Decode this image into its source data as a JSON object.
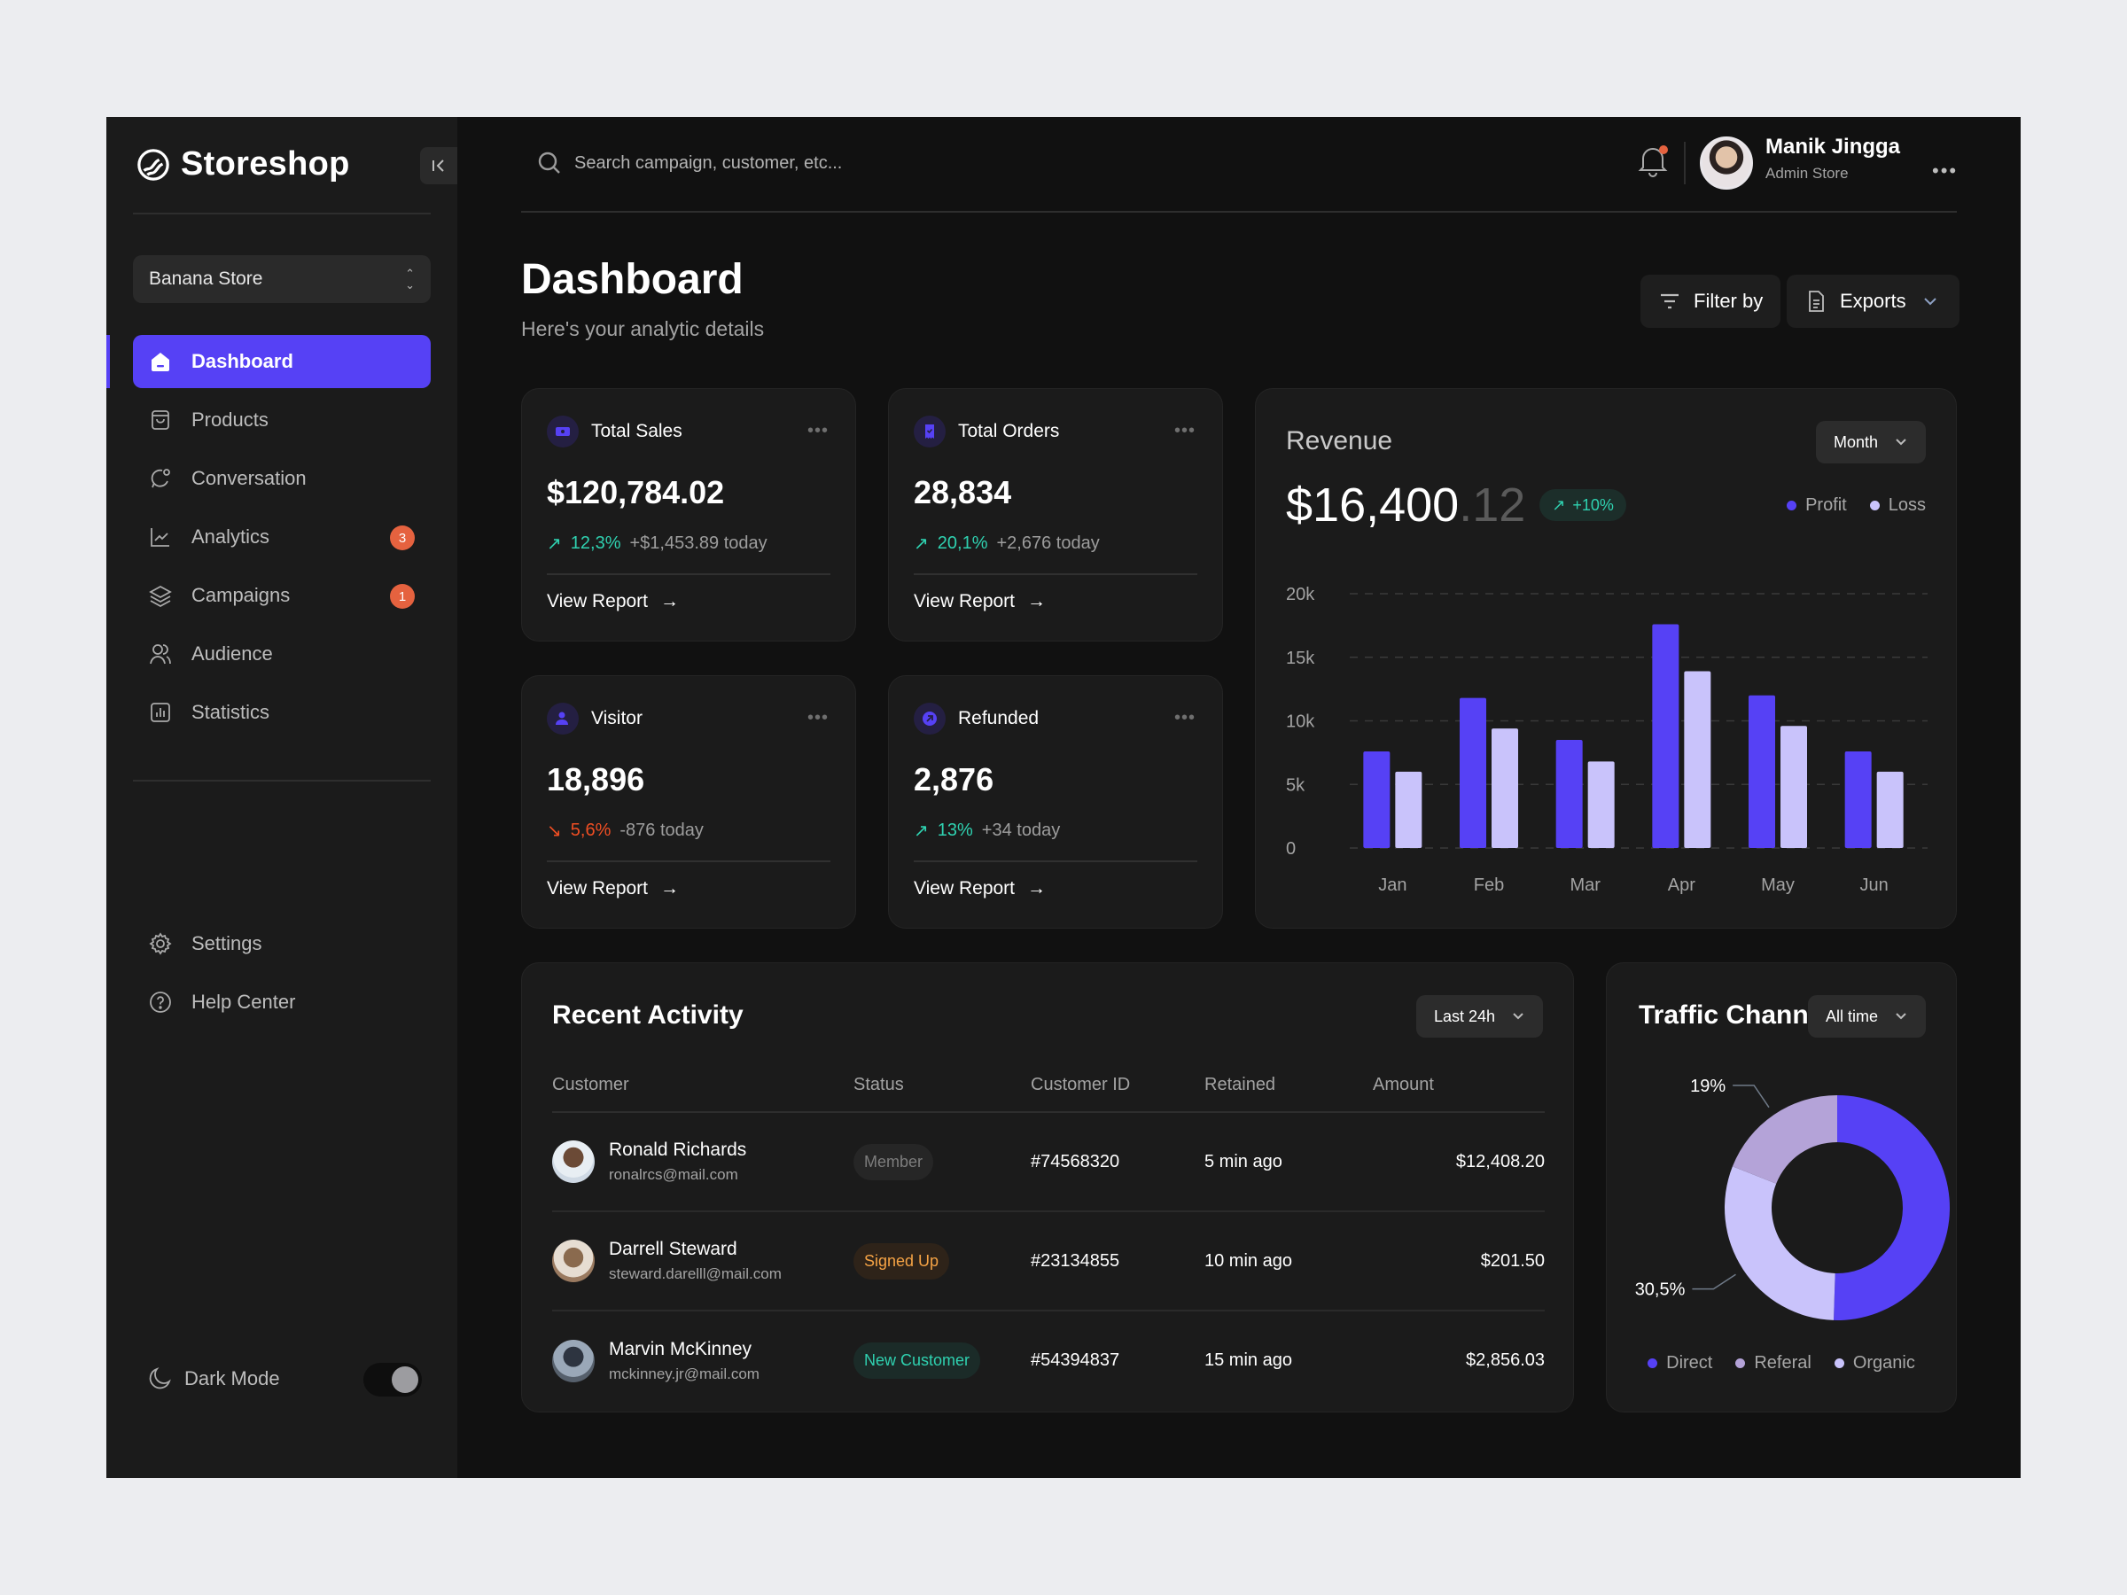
{
  "app": {
    "name": "Storeshop"
  },
  "sidebar": {
    "store_selector": "Banana Store",
    "items": [
      {
        "label": "Dashboard",
        "icon": "home-icon",
        "active": true
      },
      {
        "label": "Products",
        "icon": "shopping-bag-icon"
      },
      {
        "label": "Conversation",
        "icon": "chat-icon"
      },
      {
        "label": "Analytics",
        "icon": "line-chart-icon",
        "badge": "3"
      },
      {
        "label": "Campaigns",
        "icon": "layers-icon",
        "badge": "1"
      },
      {
        "label": "Audience",
        "icon": "users-icon"
      },
      {
        "label": "Statistics",
        "icon": "bar-chart-icon"
      }
    ],
    "bottom_items": [
      {
        "label": "Settings",
        "icon": "gear-icon"
      },
      {
        "label": "Help Center",
        "icon": "help-circle-icon"
      }
    ],
    "dark_mode": {
      "label": "Dark Mode",
      "enabled": true
    }
  },
  "header": {
    "search_placeholder": "Search campaign, customer, etc...",
    "user": {
      "name": "Manik Jingga",
      "role": "Admin Store"
    }
  },
  "page": {
    "title": "Dashboard",
    "subtitle": "Here's your analytic details",
    "filter_label": "Filter by",
    "exports_label": "Exports"
  },
  "stats": [
    {
      "title": "Total Sales",
      "value": "$120,784.02",
      "change": "12,3%",
      "direction": "up",
      "today": "+$1,453.89 today",
      "link": "View Report"
    },
    {
      "title": "Total Orders",
      "value": "28,834",
      "change": "20,1%",
      "direction": "up",
      "today": "+2,676 today",
      "link": "View Report"
    },
    {
      "title": "Visitor",
      "value": "18,896",
      "change": "5,6%",
      "direction": "down",
      "today": "-876 today",
      "link": "View Report"
    },
    {
      "title": "Refunded",
      "value": "2,876",
      "change": "13%",
      "direction": "up",
      "today": "+34 today",
      "link": "View Report"
    }
  ],
  "revenue": {
    "title": "Revenue",
    "value_main": "$16,400",
    "value_cents": ".12",
    "change": "+10%",
    "period": "Month"
  },
  "chart_data": [
    {
      "type": "bar",
      "title": "Revenue",
      "categories": [
        "Jan",
        "Feb",
        "Mar",
        "Apr",
        "May",
        "Jun"
      ],
      "series": [
        {
          "name": "Profit",
          "color": "#5641f5",
          "values": [
            7600,
            11800,
            8500,
            17600,
            12000,
            7600
          ]
        },
        {
          "name": "Loss",
          "color": "#c9c3fb",
          "values": [
            6000,
            9400,
            6800,
            13900,
            9600,
            6000
          ]
        }
      ],
      "yticks": [
        "0",
        "5k",
        "10k",
        "15k",
        "20k"
      ],
      "ylim": [
        0,
        20000
      ],
      "grid": true,
      "legend": "top-right"
    },
    {
      "type": "pie",
      "title": "Traffic Channel",
      "slices": [
        {
          "name": "Direct",
          "value": 50.5,
          "label": "50,5%",
          "color": "#5641f5"
        },
        {
          "name": "Organic",
          "value": 30.5,
          "label": "30,5%",
          "color": "#c9c3fb"
        },
        {
          "name": "Referal",
          "value": 19,
          "label": "19%",
          "color": "#b4a3d8"
        }
      ],
      "legend_order": [
        "Direct",
        "Referal",
        "Organic"
      ],
      "legend": "bottom"
    }
  ],
  "activity": {
    "title": "Recent Activity",
    "period": "Last 24h",
    "columns": [
      "Customer",
      "Status",
      "Customer ID",
      "Retained",
      "Amount"
    ],
    "rows": [
      {
        "name": "Ronald Richards",
        "email": "ronalrcs@mail.com",
        "status": "Member",
        "status_type": "member",
        "id": "#74568320",
        "retained": "5 min ago",
        "amount": "$12,408.20"
      },
      {
        "name": "Darrell Steward",
        "email": "steward.darelll@mail.com",
        "status": "Signed Up",
        "status_type": "signed",
        "id": "#23134855",
        "retained": "10 min ago",
        "amount": "$201.50"
      },
      {
        "name": "Marvin McKinney",
        "email": "mckinney.jr@mail.com",
        "status": "New Customer",
        "status_type": "new",
        "id": "#54394837",
        "retained": "15 min ago",
        "amount": "$2,856.03"
      }
    ]
  },
  "traffic": {
    "title": "Traffic Channel",
    "period": "All time"
  },
  "colors": {
    "accent": "#5641f5",
    "accent_light": "#c9c3fb",
    "referal": "#b4a3d8",
    "positive": "#2fd1b0",
    "negative": "#ef4e23",
    "badge": "#e5623f"
  }
}
